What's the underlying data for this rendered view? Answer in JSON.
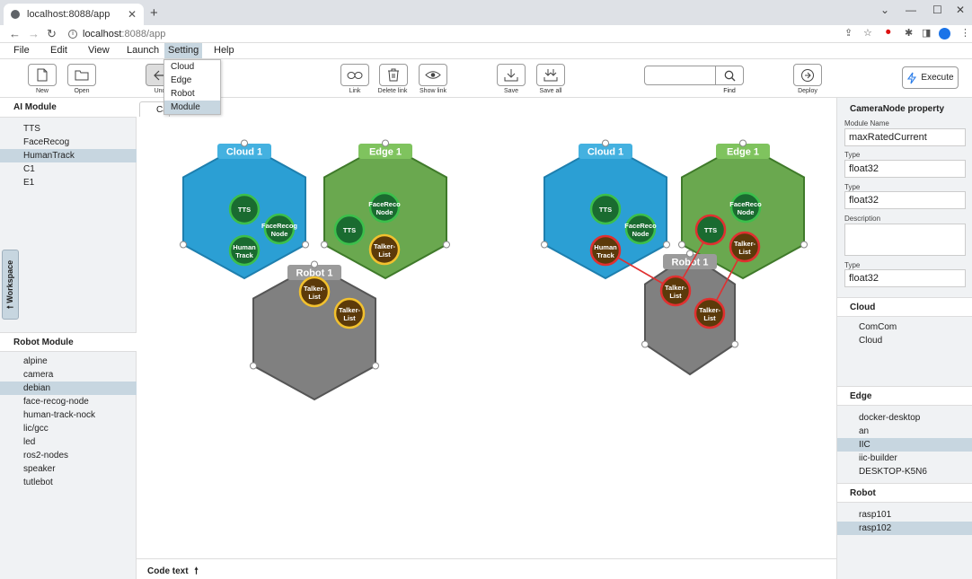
{
  "browser": {
    "tab_title": "localhost:8088/app",
    "url_host": "localhost",
    "url_path": ":8088/app"
  },
  "menubar": [
    "File",
    "Edit",
    "View",
    "Launch",
    "Setting",
    "Help"
  ],
  "setting_menu": [
    "Cloud",
    "Edge",
    "Robot",
    "Module"
  ],
  "toolbar": {
    "new": "New",
    "open": "Open",
    "undo": "Und",
    "link": "Link",
    "delete_link": "Delete link",
    "show_link": "Show link",
    "save": "Save",
    "save_all": "Save all",
    "find": "Find",
    "deploy": "Deploy",
    "execute": "Execute"
  },
  "ai_module": {
    "header": "AI Module",
    "items": [
      "TTS",
      "FaceRecog",
      "HumanTrack",
      "C1",
      "E1"
    ],
    "selected": "HumanTrack"
  },
  "workspace_tab": "Workspace",
  "robot_module": {
    "header": "Robot Module",
    "items": [
      "alpine",
      "camera",
      "debian",
      "face-recog-node",
      "human-track-nock",
      "lic/gcc",
      "led",
      "ros2-nodes",
      "speaker",
      "tutlebot"
    ],
    "selected": "debian"
  },
  "canvas": {
    "tab_label": "Ca",
    "code_text": "Code text",
    "left_group": {
      "cloud": {
        "title": "Cloud 1",
        "nodes": [
          "TTS",
          "FaceRecog Node",
          "Human Track"
        ]
      },
      "edge": {
        "title": "Edge 1",
        "nodes": [
          "FaceReco Node",
          "TTS",
          "Talker-List"
        ]
      },
      "robot": {
        "title": "Robot 1",
        "nodes": [
          "Talker-List",
          "Talker-List"
        ]
      }
    },
    "right_group": {
      "cloud": {
        "title": "Cloud 1",
        "nodes": [
          "TTS",
          "FaceReco Node",
          "Human Track"
        ]
      },
      "edge": {
        "title": "Edge 1",
        "nodes": [
          "FaceReco Node",
          "TTS",
          "Talker-List"
        ]
      },
      "robot": {
        "title": "Robot 1",
        "nodes": [
          "Talker-List",
          "Talker-List"
        ]
      }
    }
  },
  "properties": {
    "title": "CameraNode property",
    "module_name_label": "Module Name",
    "module_name": "maxRatedCurrent",
    "type_label": "Type",
    "type1": "float32",
    "type2": "float32",
    "description_label": "Description",
    "description": "",
    "type3": "float32"
  },
  "cloud_list": {
    "header": "Cloud",
    "items": [
      "ComCom",
      "Cloud"
    ]
  },
  "edge_list": {
    "header": "Edge",
    "items": [
      "docker-desktop",
      "an",
      "IIC",
      "iic-builder",
      "DESKTOP-K5N6"
    ],
    "selected": "IIC"
  },
  "robot_list": {
    "header": "Robot",
    "items": [
      "rasp101",
      "rasp102"
    ],
    "selected": "rasp102"
  },
  "colors": {
    "cloud": "#2b9fd4",
    "edge": "#6aa84f",
    "robot": "#808080",
    "node_green": "#1a6b30",
    "node_brown": "#5c3a0a",
    "link_red": "#e03030",
    "selection": "#c7d6e0"
  }
}
